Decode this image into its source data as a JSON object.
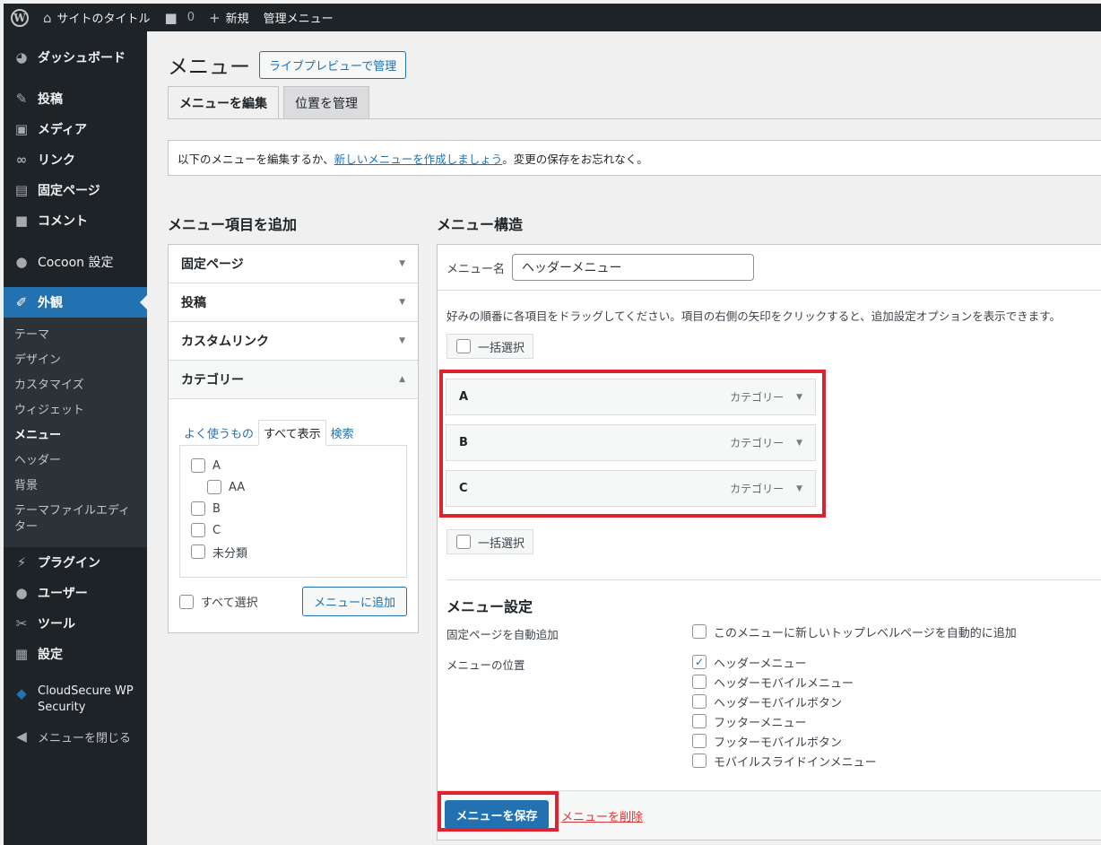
{
  "adminbar": {
    "wp_logo": "W",
    "site_title": "サイトのタイトル",
    "comments_count": "0",
    "new_label": "新規",
    "manage_menu": "管理メニュー"
  },
  "sidebar": {
    "items": [
      {
        "label": "ダッシュボード",
        "icon": "dashboard-icon"
      },
      {
        "label": "投稿",
        "icon": "pin-icon"
      },
      {
        "label": "メディア",
        "icon": "media-icon"
      },
      {
        "label": "リンク",
        "icon": "link-icon"
      },
      {
        "label": "固定ページ",
        "icon": "page-icon"
      },
      {
        "label": "コメント",
        "icon": "comment-icon"
      },
      {
        "label": "Cocoon 設定",
        "icon": "circle-icon"
      },
      {
        "label": "外観",
        "icon": "brush-icon"
      },
      {
        "label": "プラグイン",
        "icon": "plugin-icon"
      },
      {
        "label": "ユーザー",
        "icon": "user-icon"
      },
      {
        "label": "ツール",
        "icon": "wrench-icon"
      },
      {
        "label": "設定",
        "icon": "settings-icon"
      },
      {
        "label": "CloudSecure WP Security",
        "icon": "shield-icon"
      },
      {
        "label": "メニューを閉じる",
        "icon": "collapse-icon"
      }
    ],
    "submenu": [
      "テーマ",
      "デザイン",
      "カスタマイズ",
      "ウィジェット",
      "メニュー",
      "ヘッダー",
      "背景",
      "テーマファイルエディター"
    ]
  },
  "page": {
    "title": "メニュー",
    "live_preview_button": "ライブプレビューで管理",
    "tabs": [
      "メニューを編集",
      "位置を管理"
    ],
    "notice_before": "以下のメニューを編集するか、",
    "notice_link": "新しいメニューを作成しましょう",
    "notice_after": "。変更の保存をお忘れなく。"
  },
  "add_items": {
    "heading": "メニュー項目を追加",
    "sections": [
      "固定ページ",
      "投稿",
      "カスタムリンク",
      "カテゴリー"
    ],
    "category_tabs": [
      "よく使うもの",
      "すべて表示",
      "検索"
    ],
    "categories": [
      {
        "label": "A",
        "indent": false
      },
      {
        "label": "AA",
        "indent": true
      },
      {
        "label": "B",
        "indent": false
      },
      {
        "label": "C",
        "indent": false
      },
      {
        "label": "未分類",
        "indent": false
      }
    ],
    "select_all": "すべて選択",
    "add_button": "メニューに追加"
  },
  "structure": {
    "heading": "メニュー構造",
    "menu_name_label": "メニュー名",
    "menu_name_value": "ヘッダーメニュー",
    "instructions": "好みの順番に各項目をドラッグしてください。項目の右側の矢印をクリックすると、追加設定オプションを表示できます。",
    "bulk_select": "一括選択",
    "items": [
      {
        "title": "A",
        "type": "カテゴリー"
      },
      {
        "title": "B",
        "type": "カテゴリー"
      },
      {
        "title": "C",
        "type": "カテゴリー"
      }
    ]
  },
  "settings": {
    "heading": "メニュー設定",
    "auto_add_label": "固定ページを自動追加",
    "auto_add_option": "このメニューに新しいトップレベルページを自動的に追加",
    "location_label": "メニューの位置",
    "locations": [
      {
        "label": "ヘッダーメニュー",
        "checked": true
      },
      {
        "label": "ヘッダーモバイルメニュー",
        "checked": false
      },
      {
        "label": "ヘッダーモバイルボタン",
        "checked": false
      },
      {
        "label": "フッターメニュー",
        "checked": false
      },
      {
        "label": "フッターモバイルボタン",
        "checked": false
      },
      {
        "label": "モバイルスライドインメニュー",
        "checked": false
      }
    ],
    "save_button": "メニューを保存",
    "delete_link": "メニューを削除"
  },
  "colors": {
    "admin_dark": "#1d2327",
    "accent": "#2271b1",
    "highlight_red": "#e0212f",
    "delete_red": "#d63638"
  }
}
